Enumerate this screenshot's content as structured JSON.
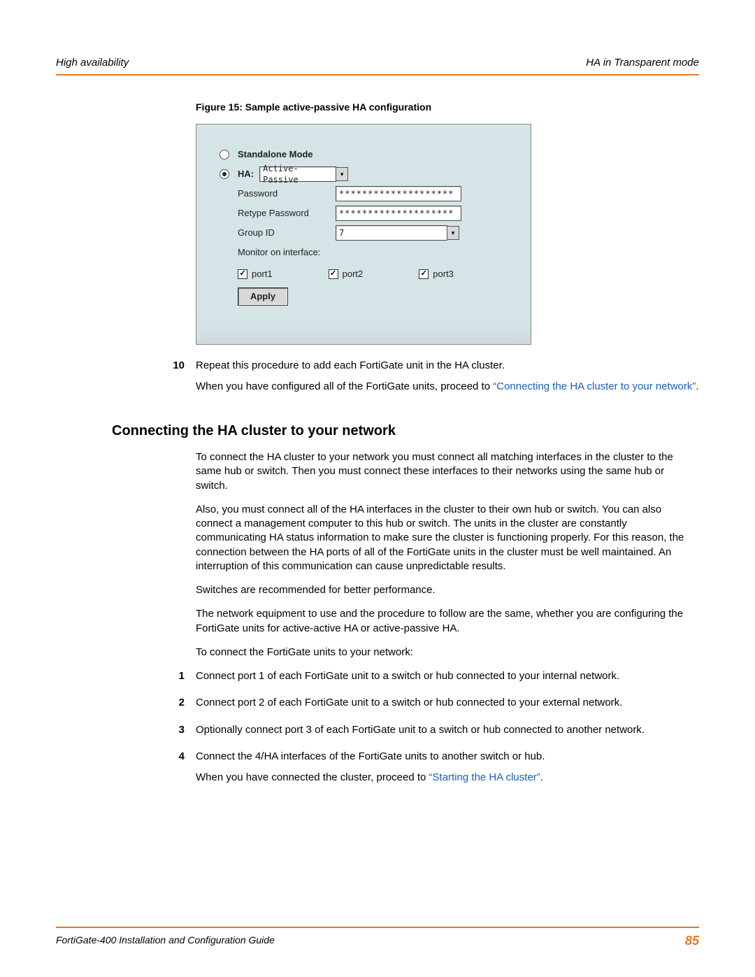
{
  "header": {
    "left": "High availability",
    "right": "HA in Transparent mode"
  },
  "figure": {
    "caption": "Figure 15: Sample active-passive HA configuration",
    "mode_standalone": "Standalone Mode",
    "mode_ha_label": "HA:",
    "ha_select_value": "Active-Passive",
    "password_label": "Password",
    "password_value": "********************",
    "retype_label": "Retype Password",
    "retype_value": "********************",
    "group_label": "Group ID",
    "group_value": "7",
    "monitor_label": "Monitor on interface:",
    "port1": "port1",
    "port2": "port2",
    "port3": "port3",
    "apply": "Apply"
  },
  "step10": {
    "num": "10",
    "line1": "Repeat this procedure to add each FortiGate unit in the HA cluster.",
    "line2a": "When you have configured all of the FortiGate units, proceed to ",
    "line2link": "“Connecting the HA cluster to your network”",
    "line2b": "."
  },
  "section": {
    "heading": "Connecting the HA cluster to your network",
    "p1": "To connect the HA cluster to your network you must connect all matching interfaces in the cluster to the same hub or switch. Then you must connect these interfaces to their networks using the same hub or switch.",
    "p2": "Also, you must connect all of the HA interfaces in the cluster to their own hub or switch. You can also connect a management computer to this hub or switch. The units in the cluster are constantly communicating HA status information to make sure the cluster is functioning properly. For this reason, the connection between the HA ports of all of the FortiGate units in the cluster must be well maintained. An interruption of this communication can cause unpredictable results.",
    "p3": "Switches are recommended for better performance.",
    "p4": "The network equipment to use and the procedure to follow are the same, whether you are configuring the FortiGate units for active-active HA or active-passive HA.",
    "p5": "To connect the FortiGate units to your network:"
  },
  "steps": [
    {
      "num": "1",
      "text": "Connect port 1 of each FortiGate unit to a switch or hub connected to your internal network."
    },
    {
      "num": "2",
      "text": "Connect port 2 of each FortiGate unit to a switch or hub connected to your external network."
    },
    {
      "num": "3",
      "text": "Optionally connect port 3 of each FortiGate unit to a switch or hub connected to another network."
    },
    {
      "num": "4",
      "text": "Connect the 4/HA interfaces of the FortiGate units to another switch or hub."
    }
  ],
  "step4_followup_a": "When you have connected the cluster, proceed to ",
  "step4_followup_link": "“Starting the HA cluster”",
  "step4_followup_b": ".",
  "footer": {
    "left": "FortiGate-400 Installation and Configuration Guide",
    "page": "85"
  }
}
